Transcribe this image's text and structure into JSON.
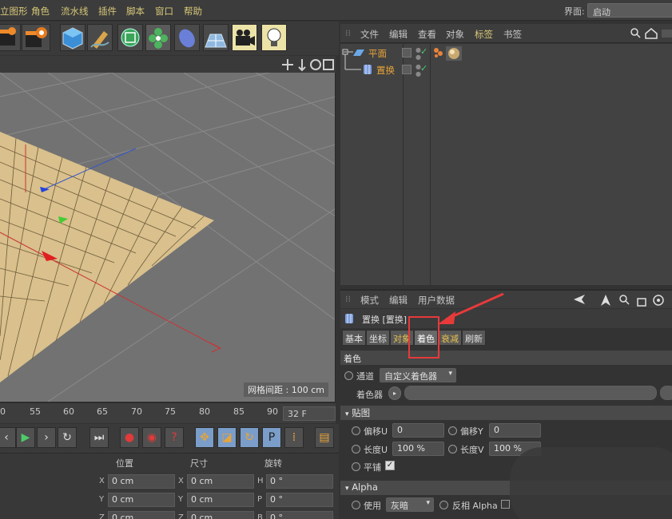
{
  "menubar": {
    "items": [
      "立图形",
      "角色",
      "流水线",
      "插件",
      "脚本",
      "窗口",
      "帮助"
    ],
    "layout_label": "界面:",
    "layout_value": "启动"
  },
  "viewport": {
    "grid_status": "网格间距 : 100 cm"
  },
  "timeline": {
    "ticks": [
      "0",
      "55",
      "60",
      "65",
      "70",
      "75",
      "80",
      "85",
      "90"
    ],
    "frame": "32 F"
  },
  "coordinates": {
    "headers": [
      "位置",
      "尺寸",
      "旋转"
    ],
    "axes_pos": [
      "X",
      "Y",
      "Z"
    ],
    "axes_size": [
      "X",
      "Y",
      "Z"
    ],
    "axes_rot": [
      "H",
      "P",
      "B"
    ],
    "pos_values": [
      "0 cm",
      "0 cm",
      "0 cm"
    ],
    "size_values": [
      "0 cm",
      "0 cm",
      "0 cm"
    ],
    "rot_values": [
      "0 °",
      "0 °",
      "0 °"
    ]
  },
  "object_manager": {
    "menu": [
      "文件",
      "编辑",
      "查看",
      "对象",
      "标签",
      "书签"
    ],
    "objects": [
      {
        "name": "平面"
      },
      {
        "name": "置换"
      }
    ]
  },
  "attribute_manager": {
    "menu": [
      "模式",
      "编辑",
      "用户数据"
    ],
    "title": "置换 [置换]",
    "tabs": [
      "基本",
      "坐标",
      "对象",
      "着色",
      "衰减",
      "刷新"
    ],
    "active_tab": "着色",
    "section_shading": "着色",
    "channel_label": "通道",
    "channel_value": "自定义着色器",
    "shader_label": "着色器",
    "section_texture": "贴图",
    "offset_u_label": "偏移U",
    "offset_u_value": "0",
    "offset_v_label": "偏移Y",
    "offset_v_value": "0",
    "length_u_label": "长度U",
    "length_u_value": "100 %",
    "length_v_label": "长度V",
    "length_v_value": "100 %",
    "tile_label": "平铺",
    "section_alpha": "Alpha",
    "use_label": "使用",
    "use_value": "灰暗",
    "invert_label": "反相 Alpha"
  },
  "colors": {
    "accent": "#e8a43a",
    "highlight": "#e73a3a",
    "menu_text": "#d8c878"
  }
}
